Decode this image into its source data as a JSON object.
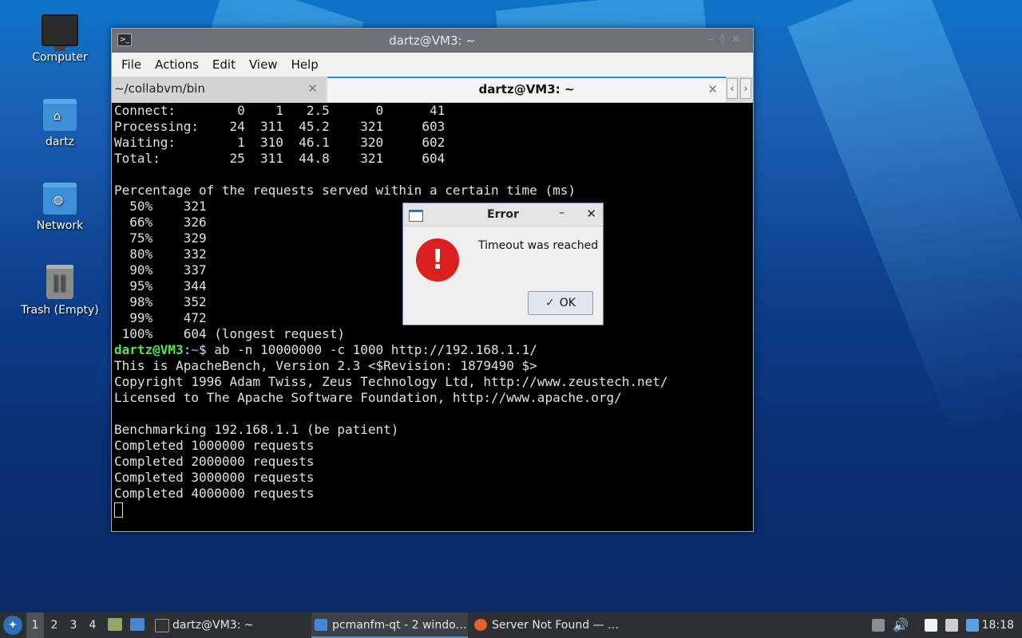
{
  "desktop": {
    "icons": [
      {
        "label": "Computer"
      },
      {
        "label": "dartz"
      },
      {
        "label": "Network"
      },
      {
        "label": "Trash (Empty)"
      }
    ]
  },
  "terminal": {
    "title": "dartz@VM3: ~",
    "menu": [
      "File",
      "Actions",
      "Edit",
      "View",
      "Help"
    ],
    "tabs": [
      {
        "label": "~/collabvm/bin",
        "active": false
      },
      {
        "label": "dartz@VM3: ~",
        "active": true
      }
    ],
    "lines": [
      "Connect:        0    1   2.5      0      41",
      "Processing:    24  311  45.2    321     603",
      "Waiting:        1  310  46.1    320     602",
      "Total:         25  311  44.8    321     604",
      "",
      "Percentage of the requests served within a certain time (ms)",
      "  50%    321",
      "  66%    326",
      "  75%    329",
      "  80%    332",
      "  90%    337",
      "  95%    344",
      "  98%    352",
      "  99%    472",
      " 100%    604 (longest request)"
    ],
    "prompt": {
      "user": "dartz@VM3",
      "sep": ":",
      "path": "~",
      "symbol": "$ ",
      "command": "ab -n 10000000 -c 1000 http://192.168.1.1/"
    },
    "lines_after": [
      "This is ApacheBench, Version 2.3 <$Revision: 1879490 $>",
      "Copyright 1996 Adam Twiss, Zeus Technology Ltd, http://www.zeustech.net/",
      "Licensed to The Apache Software Foundation, http://www.apache.org/",
      "",
      "Benchmarking 192.168.1.1 (be patient)",
      "Completed 1000000 requests",
      "Completed 2000000 requests",
      "Completed 3000000 requests",
      "Completed 4000000 requests"
    ]
  },
  "dialog": {
    "title": "Error",
    "minimize": "–",
    "close": "✕",
    "message": "Timeout was reached",
    "ok_label": "OK",
    "icon_glyph": "!"
  },
  "taskbar": {
    "workspaces": [
      "1",
      "2",
      "3",
      "4"
    ],
    "tasks": [
      {
        "label": "dartz@VM3: ~",
        "active": false
      },
      {
        "label": "pcmanfm-qt - 2 windo…",
        "active": true
      },
      {
        "label": "Server Not Found — …",
        "active": false
      }
    ],
    "clock": "18:18"
  },
  "colors": {
    "prompt_user": "#55e34a",
    "prompt_path": "#5b8ef0",
    "error_red": "#d9201f",
    "tab_accent": "#3a89d8"
  }
}
